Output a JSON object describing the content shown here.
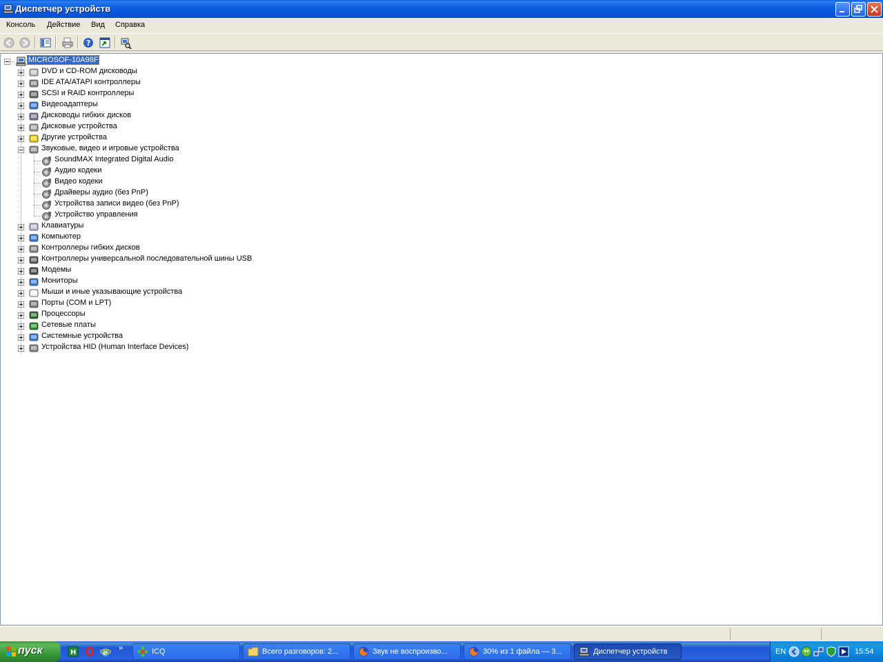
{
  "window": {
    "title": "Диспетчер устройств"
  },
  "menu": [
    "Консоль",
    "Действие",
    "Вид",
    "Справка"
  ],
  "toolbar": {
    "icons": [
      "back-icon",
      "forward-icon",
      "show-hide-console-tree-icon",
      "print-icon",
      "help-icon",
      "export-icon",
      "scan-hardware-icon"
    ]
  },
  "tree": {
    "root": "MICROSOF-10A98F",
    "categories": [
      "DVD и CD-ROM дисководы",
      "IDE ATA/ATAPI контроллеры",
      "SCSI и RAID контроллеры",
      "Видеоадаптеры",
      "Дисководы гибких дисков",
      "Дисковые устройства",
      "Другие устройства",
      "Звуковые, видео и игровые устройства",
      "Клавиатуры",
      "Компьютер",
      "Контроллеры гибких дисков",
      "Контроллеры универсальной последовательной шины USB",
      "Модемы",
      "Мониторы",
      "Мыши и иные указывающие устройства",
      "Порты (COM и LPT)",
      "Процессоры",
      "Сетевые платы",
      "Системные устройства",
      "Устройства HID (Human Interface Devices)"
    ],
    "expanded_children": [
      "SoundMAX Integrated Digital Audio",
      "Аудио кодеки",
      "Видео кодеки",
      "Драйверы аудио (без PnP)",
      "Устройства записи видео (без PnP)",
      "Устройство управления"
    ]
  },
  "taskbar": {
    "start_label": "пуск",
    "more_label": "»",
    "tasks": [
      "ICQ",
      "Всего разговоров: 2...",
      "Звук не воспроизво...",
      "30% из 1 файла — 3...",
      "Диспетчер устройств"
    ],
    "lang": "EN",
    "clock": "15:54"
  }
}
